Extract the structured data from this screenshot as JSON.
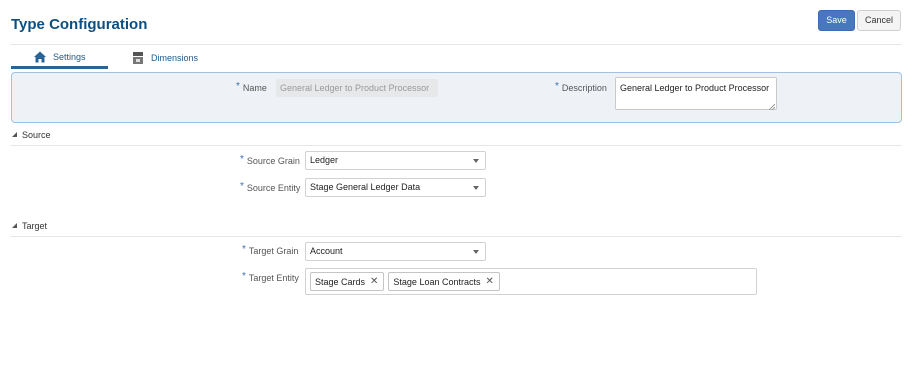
{
  "header": {
    "title": "Type Configuration",
    "save_label": "Save",
    "cancel_label": "Cancel"
  },
  "tabs": [
    {
      "label": "Settings",
      "icon": "home-icon",
      "active": true
    },
    {
      "label": "Dimensions",
      "icon": "dimensions-icon",
      "active": false
    }
  ],
  "general": {
    "name_label": "Name",
    "name_value": "General Ledger to Product Processor",
    "description_label": "Description",
    "description_value": "General Ledger to Product Processor"
  },
  "source": {
    "section_label": "Source",
    "grain_label": "Source Grain",
    "grain_value": "Ledger",
    "entity_label": "Source Entity",
    "entity_value": "Stage General Ledger Data"
  },
  "target": {
    "section_label": "Target",
    "grain_label": "Target Grain",
    "grain_value": "Account",
    "entity_label": "Target Entity",
    "entities": [
      "Stage Cards",
      "Stage Loan Contracts"
    ]
  },
  "colors": {
    "accent": "#4677bf",
    "title": "#0f4f7f",
    "panel_bg": "#eef2f6",
    "panel_border": "#9fc2e3"
  }
}
